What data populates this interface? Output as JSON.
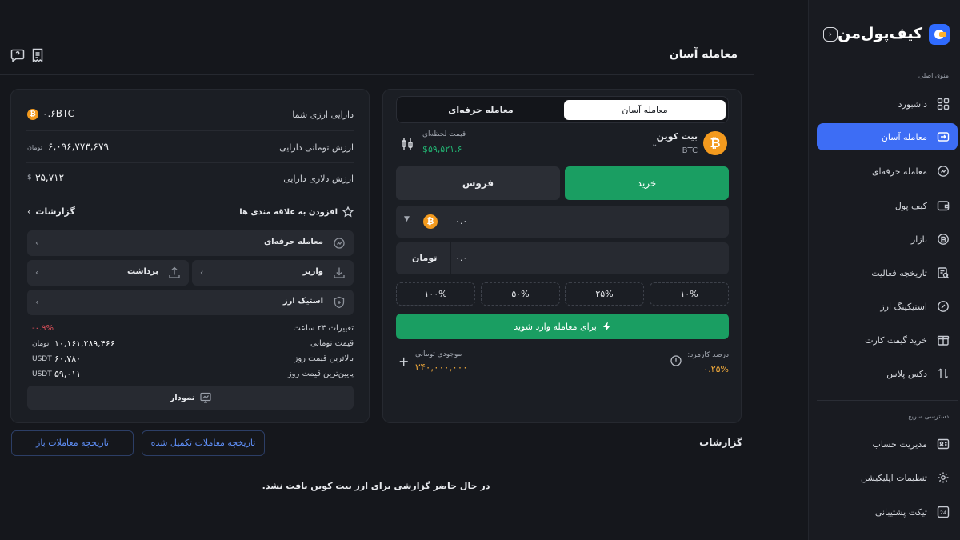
{
  "brand": {
    "name": "کیف‌پول‌من"
  },
  "sidebar": {
    "main_menu_title": "منوی اصلی",
    "items": [
      {
        "label": "داشبورد",
        "icon": "dashboard-icon"
      },
      {
        "label": "معامله آسان",
        "icon": "easy-trade-icon",
        "active": true
      },
      {
        "label": "معامله حرفه‌ای",
        "icon": "pro-trade-icon"
      },
      {
        "label": "کیف پول",
        "icon": "wallet-icon"
      },
      {
        "label": "بازار",
        "icon": "market-icon"
      },
      {
        "label": "تاریخچه فعالیت",
        "icon": "history-icon"
      },
      {
        "label": "استیکینگ ارز",
        "icon": "staking-icon"
      },
      {
        "label": "خرید گیفت کارت",
        "icon": "gift-card-icon"
      },
      {
        "label": "دکس پلاس",
        "icon": "dex-icon"
      }
    ],
    "quick_access_title": "دسترسی سریع",
    "quick_items": [
      {
        "label": "مدیریت حساب",
        "icon": "account-icon"
      },
      {
        "label": "تنظیمات اپلیکیشن",
        "icon": "settings-icon"
      },
      {
        "label": "تیکت پشتیبانی",
        "icon": "support-ticket-icon"
      }
    ]
  },
  "header": {
    "title": "معامله آسان"
  },
  "trade": {
    "tabs": {
      "easy": "معامله آسان",
      "pro": "معامله حرفه‌ای"
    },
    "coin_name": "بیت کوین",
    "coin_symbol": "BTC",
    "instant_price_label": "قیمت لحظه‌ای",
    "instant_price": "$۵۹,۵۲۱.۶",
    "buy_label": "خرید",
    "sell_label": "فروش",
    "amount_value": "۰.۰",
    "toman_value": "۰.۰",
    "toman_label": "تومان",
    "percents": [
      "۱۰%",
      "۲۵%",
      "۵۰%",
      "۱۰۰%"
    ],
    "submit_label": "برای معامله وارد شوید",
    "fee_label": "درصد کارمزد:",
    "fee_value": "۰.۲۵%",
    "balance_label": "موجودی تومانی",
    "balance_value": "۳۴۰,۰۰۰,۰۰۰"
  },
  "asset": {
    "holding_label": "دارایی ارزی شما",
    "holding_value": "۰.۶BTC",
    "toman_value_label": "ارزش تومانی دارایی",
    "toman_value": "۶,۰۹۶,۷۷۳,۶۷۹",
    "toman_unit": "تومان",
    "dollar_value_label": "ارزش دلاری دارایی",
    "dollar_value": "۳۵,۷۱۲",
    "dollar_unit": "$",
    "add_watchlist": "افزودن به علاقه مندی ها",
    "reports_link": "گزارشات",
    "actions": {
      "pro_trade": "معامله حرفه‌ای",
      "deposit": "واریز",
      "withdraw": "برداشت",
      "staking": "استیک ارز"
    },
    "stats": [
      {
        "label": "تغییرات ۲۴ ساعت",
        "value": "-۰.۹%",
        "negative": true
      },
      {
        "label": "قیمت تومانی",
        "value": "۱۰,۱۶۱,۲۸۹,۴۶۶",
        "unit": "تومان"
      },
      {
        "label": "بالاترین قیمت روز",
        "value": "۶۰,۷۸۰",
        "unit": "USDT"
      },
      {
        "label": "پایین‌ترین قیمت روز",
        "value": "۵۹,۰۱۱",
        "unit": "USDT"
      }
    ],
    "chart_button": "نمودار"
  },
  "reports": {
    "title": "گزارشات",
    "completed_history": "تاریخچه معاملات تکمیل شده",
    "open_history": "تاریخچه معاملات باز",
    "empty_message": "در حال حاضر گزارشی برای ارز بیت کوین یافت نشد."
  },
  "colors": {
    "accent": "#3d6df5",
    "buy": "#1a9e62",
    "negative": "#e0505a",
    "gold": "#f0a93b",
    "price_green": "#22b573"
  }
}
